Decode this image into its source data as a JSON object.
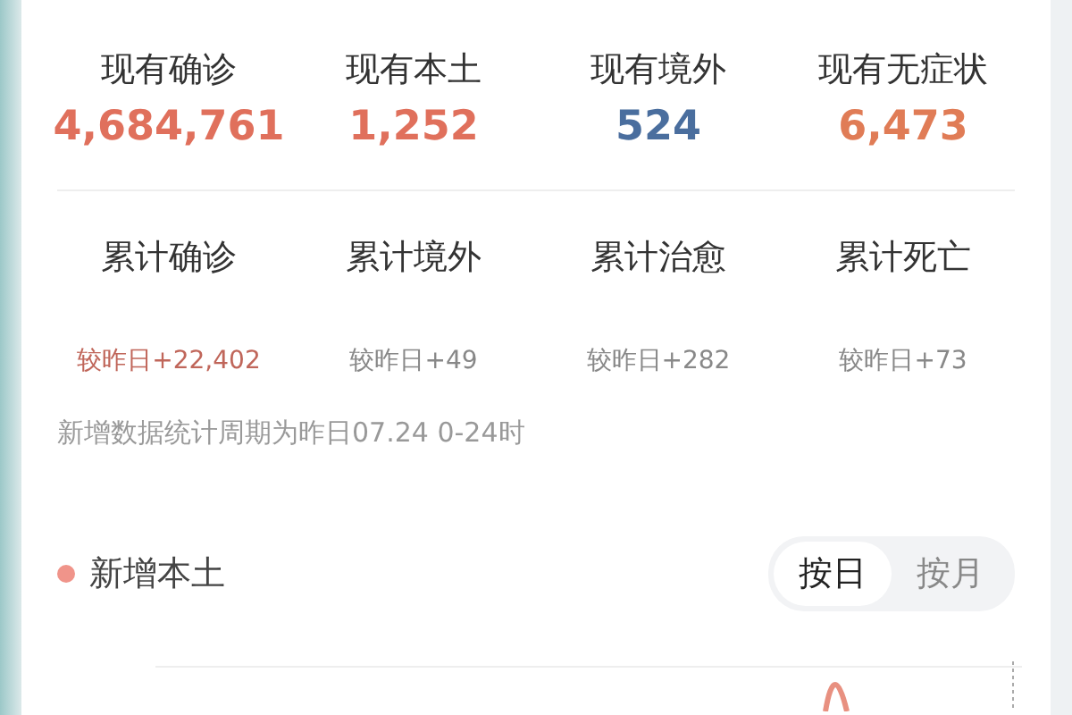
{
  "current_stats": [
    {
      "label": "现有确诊",
      "value": "4,684,761",
      "color": "#e0705c"
    },
    {
      "label": "现有本土",
      "value": "1,252",
      "color": "#e0705c"
    },
    {
      "label": "现有境外",
      "value": "524",
      "color": "#4a6e9e"
    },
    {
      "label": "现有无症状",
      "value": "6,473",
      "color": "#e07c56"
    }
  ],
  "total_stats": [
    {
      "label": "累计确诊",
      "delta": "较昨日+22,402",
      "color": "#c0665a"
    },
    {
      "label": "累计境外",
      "delta": "较昨日+49",
      "color": "#888888"
    },
    {
      "label": "累计治愈",
      "delta": "较昨日+282",
      "color": "#888888"
    },
    {
      "label": "累计死亡",
      "delta": "较昨日+73",
      "color": "#888888"
    }
  ],
  "note": "新增数据统计周期为昨日07.24 0-24时",
  "section": {
    "title": "新增本土",
    "color": "#f0948a"
  },
  "toggle": [
    {
      "label": "按日",
      "selected": true
    },
    {
      "label": "按月",
      "selected": false
    }
  ]
}
